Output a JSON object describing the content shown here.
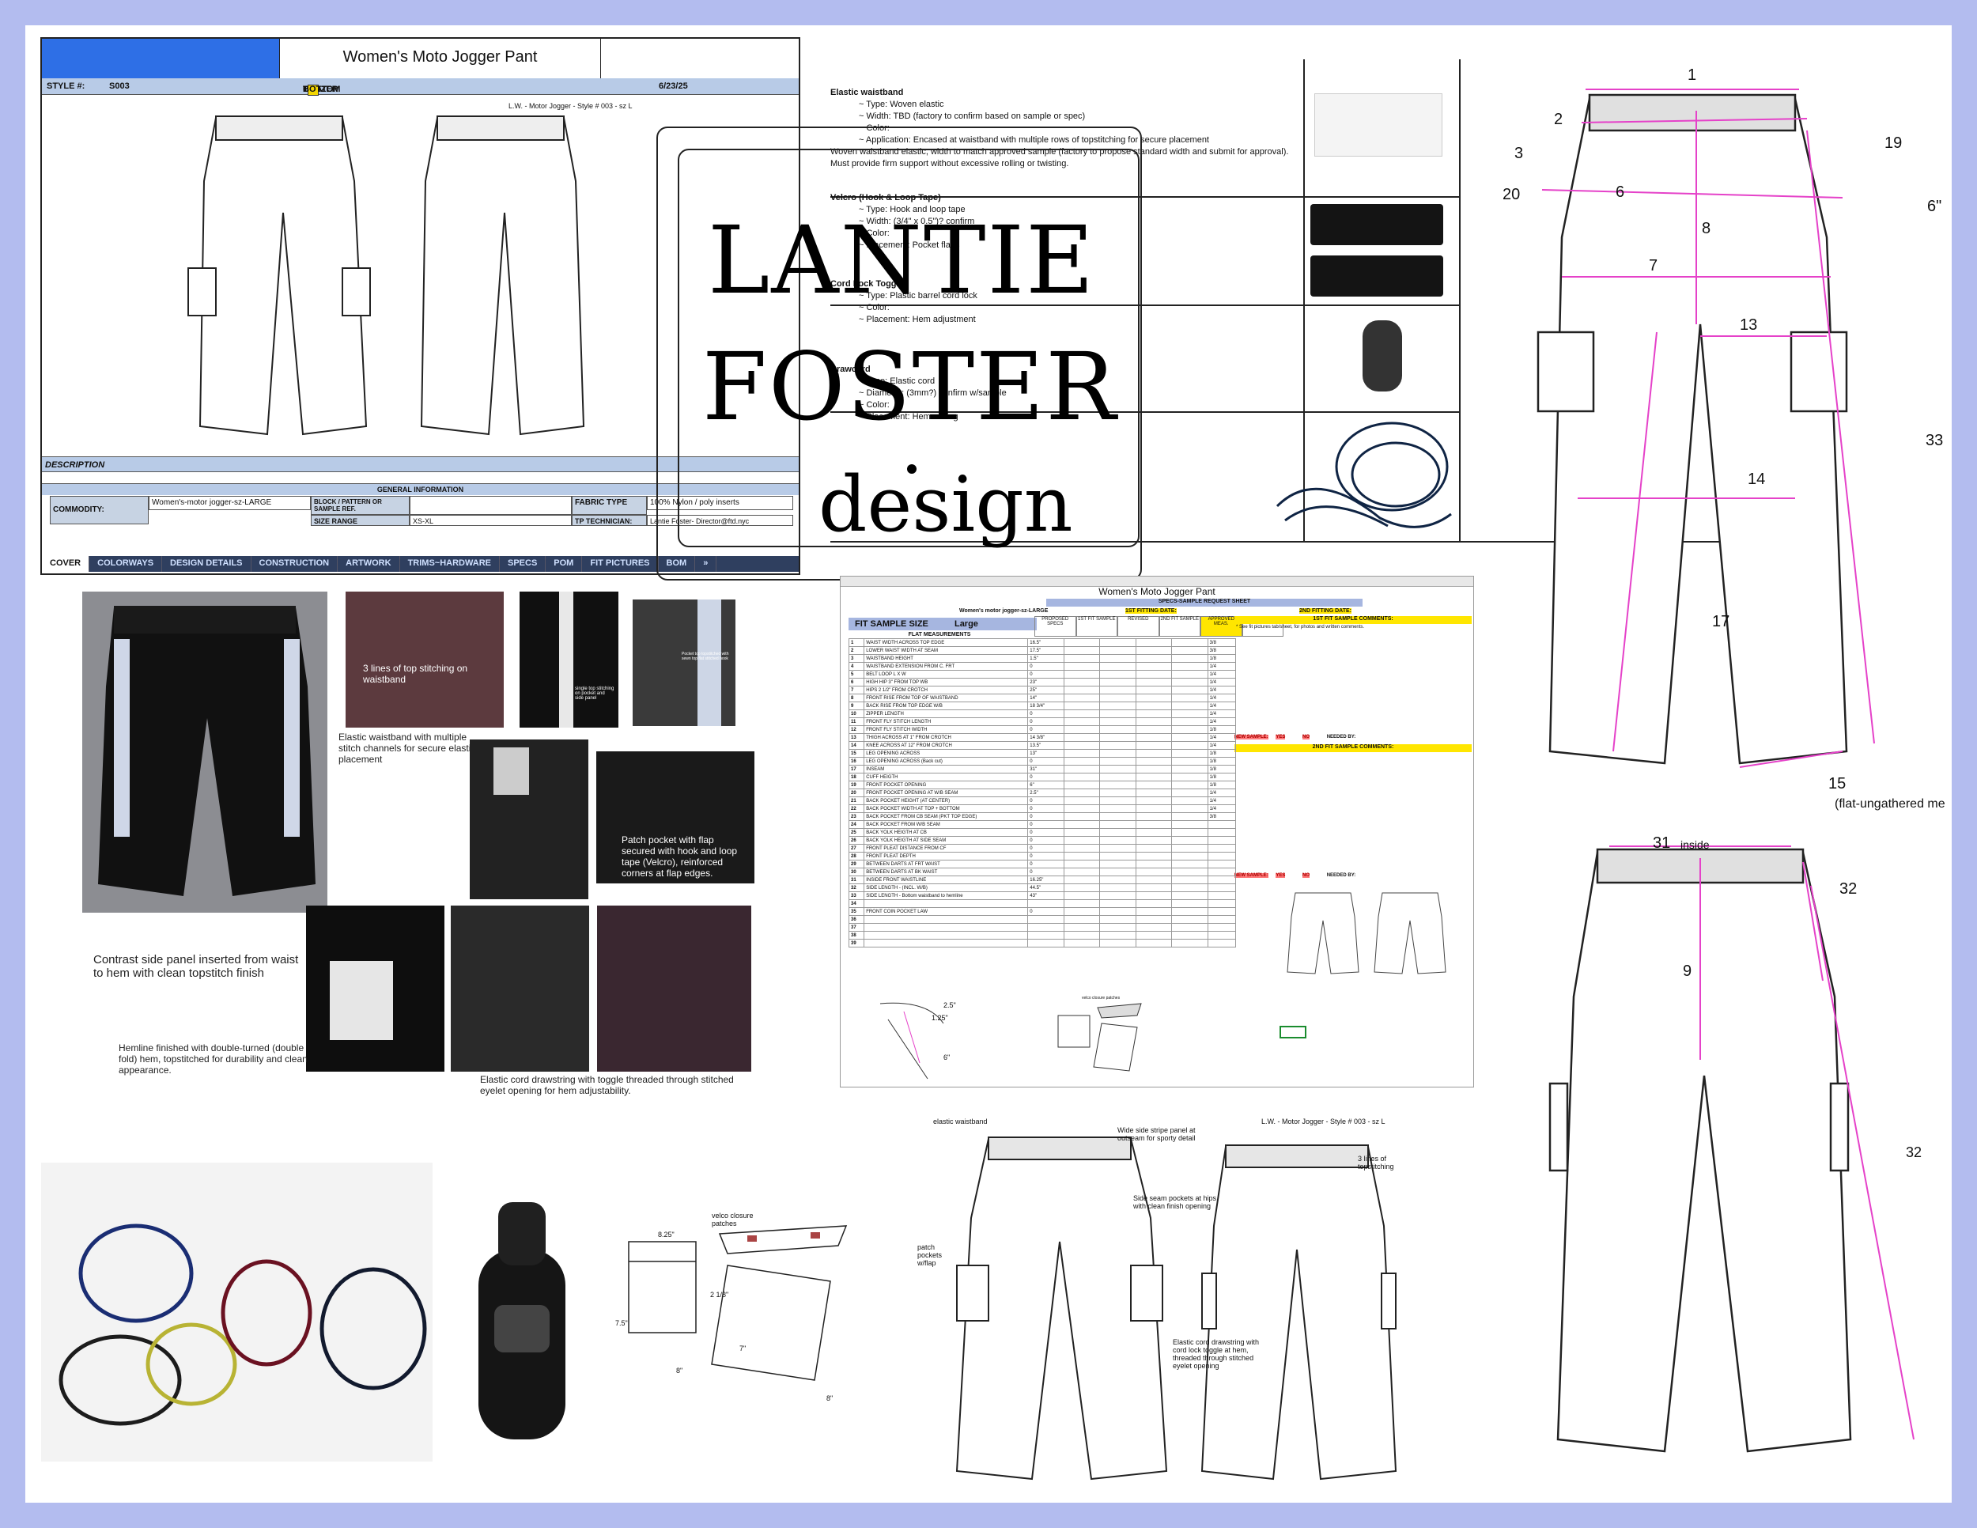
{
  "cover": {
    "title": "Women's Moto Jogger Pant",
    "style_label": "STYLE #:",
    "style_value": "S003",
    "categories": [
      "COAT",
      "BLAZER",
      "TOP",
      "BOTTOM"
    ],
    "date": "6/23/25",
    "sketch_label": "L.W. - Motor Jogger - Style # 003 - sz L",
    "description_label": "DESCRIPTION",
    "general_info_label": "GENERAL INFORMATION",
    "commodity_label": "COMMODITY:",
    "commodity_value": "Women's-motor jogger-sz-LARGE",
    "block_label": "BLOCK / PATTERN OR SAMPLE REF.",
    "size_range_label": "SIZE RANGE",
    "size_range_value": "XS-XL",
    "fabric_label": "FABRIC TYPE",
    "fabric_value": "100% Nylon / poly inserts",
    "tech_label": "TP TECHNICIAN:",
    "tech_value": "Lantie Foster- Director@ftd.nyc",
    "tabs": [
      "COVER",
      "COLORWAYS",
      "DESIGN DETAILS",
      "CONSTRUCTION",
      "ARTWORK",
      "TRIMS~HARDWARE",
      "SPECS",
      "POM",
      "FIT PICTURES",
      "BOM",
      "»"
    ]
  },
  "trims": [
    {
      "title": "Elastic waistband",
      "lines": [
        "~ Type: Woven elastic",
        "~ Width: TBD (factory to confirm based on sample or spec)",
        "~ Color:",
        "~ Application: Encased at waistband with multiple rows of topstitching for secure placement"
      ],
      "note": "Woven waistband elastic, width to match approved sample (factory to propose standard width and submit for approval). Must provide firm support without excessive rolling or twisting."
    },
    {
      "title": "Velcro (Hook & Loop Tape)",
      "lines": [
        "~ Type: Hook and loop tape",
        "~ Width: (3/4\" x 0.5\")? confirm",
        "~ Color:",
        "~ Placement: Pocket flaps"
      ]
    },
    {
      "title": "Cord Lock Toggle",
      "lines": [
        "~ Type: Plastic barrel cord lock",
        "~ Color:",
        "~ Placement: Hem adjustment"
      ]
    },
    {
      "title": "Drawcord",
      "lines": [
        "~ Type: Elastic cord",
        "~ Diameter: (3mm?) confirm w/sample",
        "~ Color:",
        "~ Placement: Hem casing"
      ]
    }
  ],
  "logo": {
    "line1": "LANTIE",
    "line2": "FOSTER",
    "line3": "design"
  },
  "photos_captions": {
    "waistband_stitch": "3 lines of top stitching on waistband",
    "elastic_waistband": "Elastic waistband with multiple stitch channels for secure elastic placement",
    "single_top": "single top stitching on pocket and side panel",
    "pocket_top": "Pocket top topstitched with sewn top flat stitched hook",
    "patch_pocket": "Patch pocket with flap secured with hook and loop tape (Velcro), reinforced corners at flap edges.",
    "contrast_panel": "Contrast side panel inserted from waist to hem with clean topstitch finish",
    "hemline": "Hemline finished with double-turned (double fold) hem, topstitched for durability and clean appearance.",
    "drawstring": "Elastic cord drawstring with toggle threaded through stitched eyelet opening for hem adjustability."
  },
  "sheet": {
    "title": "Women's Moto Jogger Pant",
    "subtitle": "SPECS-SAMPLE REQUEST SHEET",
    "commodity": "Women's motor jogger-sz-LARGE",
    "first_fitting": "1ST FITTING DATE:",
    "second_fitting": "2ND FITTING DATE:",
    "fit_sample_size_label": "FIT SAMPLE SIZE",
    "fit_sample_size": "Large",
    "flat_measurements": "FLAT MEASUREMENTS",
    "col_headers": [
      "PROPOSED SPECS",
      "1ST FIT SAMPLE",
      "REVISED",
      "2ND FIT SAMPLE",
      "APPROVED MEAS.",
      "TOLER."
    ],
    "first_comments": "1ST FIT SAMPLE COMMENTS:",
    "first_comments_note": "* See fit pictures tab/sheet, for photos and written comments.",
    "second_comments": "2ND FIT SAMPLE COMMENTS:",
    "new_sample": "NEW SAMPLE:",
    "yes": "YES",
    "no": "NO",
    "needed_by": "NEEDED BY:",
    "rows": [
      [
        "1",
        "WAIST WIDTH ACROSS TOP EDGE",
        "16.5\"",
        "3/8"
      ],
      [
        "2",
        "LOWER WAIST WIDTH AT SEAM",
        "17.5\"",
        "3/8"
      ],
      [
        "3",
        "WAISTBAND HEIGHT",
        "1.5\"",
        "1/8"
      ],
      [
        "4",
        "WAISTBAND EXTENSION FROM C. FRT",
        "0",
        "1/4"
      ],
      [
        "5",
        "BELT LOOP L X W",
        "0",
        "1/4"
      ],
      [
        "6",
        "HIGH HIP 3\" FROM TOP WB",
        "23\"",
        "1/4"
      ],
      [
        "7",
        "HIPS 2 1/2\" FROM CROTCH",
        "25\"",
        "1/4"
      ],
      [
        "8",
        "FRONT RISE FROM TOP OF WAISTBAND",
        "14\"",
        "1/4"
      ],
      [
        "9",
        "BACK RISE FROM TOP EDGE W/B",
        "18 3/4\"",
        "1/4"
      ],
      [
        "10",
        "ZIPPER LENGTH",
        "0",
        "1/4"
      ],
      [
        "11",
        "FRONT FLY STITCH LENGTH",
        "0",
        "1/4"
      ],
      [
        "12",
        "FRONT FLY STITCH WIDTH",
        "0",
        "1/8"
      ],
      [
        "13",
        "THIGH ACROSS AT 1\" FROM CROTCH",
        "14 3/8\"",
        "1/4"
      ],
      [
        "14",
        "KNEE ACROSS AT 12\" FROM CROTCH",
        "13.5\"",
        "1/4"
      ],
      [
        "15",
        "LEG OPENING ACROSS",
        "13\"",
        "1/8"
      ],
      [
        "16",
        "LEG OPENING ACROSS (Back cut)",
        "0",
        "1/8"
      ],
      [
        "17",
        "INSEAM",
        "31\"",
        "1/8"
      ],
      [
        "18",
        "CUFF HEIGTH",
        "0",
        "1/8"
      ],
      [
        "19",
        "FRONT POCKET OPENING",
        "6\"",
        "1/8"
      ],
      [
        "20",
        "FRONT POCKET OPENING AT W/B SEAM",
        "2.5\"",
        "1/4"
      ],
      [
        "21",
        "BACK POCKET HEIGHT (AT CENTER)",
        "0",
        "1/4"
      ],
      [
        "22",
        "BACK POCKET WIDTH AT TOP + BOTTOM",
        "0",
        "1/4"
      ],
      [
        "23",
        "BACK POCKET FROM CB SEAM (PKT TOP EDGE)",
        "0",
        "3/8"
      ],
      [
        "24",
        "BACK POCKET FROM W/B SEAM",
        "0",
        ""
      ],
      [
        "25",
        "BACK YOLK HEIGTH AT CB",
        "0",
        ""
      ],
      [
        "26",
        "BACK YOLK HEIGTH AT SIDE SEAM",
        "0",
        ""
      ],
      [
        "27",
        "FRONT PLEAT DISTANCE FROM CF",
        "0",
        ""
      ],
      [
        "28",
        "FRONT PLEAT DEPTH",
        "0",
        ""
      ],
      [
        "29",
        "BETWEEN DARTS AT FRT WAIST",
        "0",
        ""
      ],
      [
        "30",
        "BETWEEN DARTS AT BK WAIST",
        "0",
        ""
      ],
      [
        "31",
        "INSIDE FRONT WAISTLINE",
        "16.25\"",
        ""
      ],
      [
        "32",
        "SIDE LENGTH - (INCL. W/B)",
        "44.5\"",
        ""
      ],
      [
        "33",
        "SIDE LENGTH - Bottom waistband to hemline",
        "43\"",
        ""
      ],
      [
        "34",
        "",
        "",
        ""
      ],
      [
        "35",
        "FRONT COIN POCKET LAW",
        "0",
        ""
      ],
      [
        "36",
        "",
        "",
        ""
      ],
      [
        "37",
        "",
        "",
        ""
      ],
      [
        "38",
        "",
        "",
        ""
      ],
      [
        "39",
        "",
        "",
        ""
      ]
    ],
    "pocket_dims": [
      "2.5\"",
      "1.25\"",
      "6\""
    ],
    "velcro_note": "velco closure patches"
  },
  "pom_labels": [
    "1",
    "2",
    "3",
    "19",
    "20",
    "6",
    "6\"",
    "8",
    "7",
    "13",
    "33",
    "14",
    "17",
    "15"
  ],
  "pom_note": "(flat-ungathered me",
  "pom_back": [
    "31",
    "inside",
    "32",
    "9",
    "32"
  ],
  "pocket_diagram": {
    "velcro": "velco closure patches",
    "w": "8.25\"",
    "h": "7.5\"",
    "b": "8\"",
    "s": "2 1/8\"",
    "d": "7\"",
    "e": "8\""
  },
  "flat_callouts": {
    "elastic": "elastic waistband",
    "stripe": "Wide side stripe panel at outseam for sporty detail",
    "sketch_label": "L.W. - Motor Jogger - Style # 003 - sz L",
    "topstitch": "3 lines of topstitching",
    "side_pockets": "Side seam pockets at hips with clean finish opening",
    "patch": "patch pockets w/flap",
    "cord": "Elastic cord drawstring with cord lock toggle at hem, threaded through stitched eyelet opening"
  }
}
